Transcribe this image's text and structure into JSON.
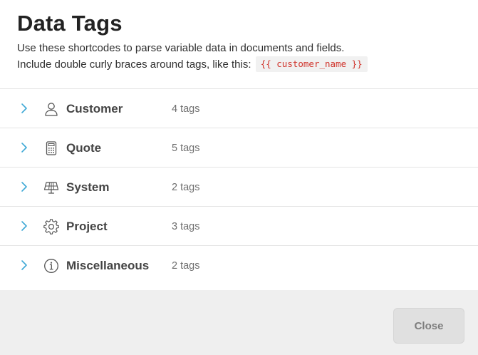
{
  "header": {
    "title": "Data Tags",
    "desc_line1": "Use these shortcodes to parse variable data in documents and fields.",
    "desc_line2": "Include double curly braces around tags, like this:",
    "example_code": "{{ customer_name }}"
  },
  "categories": [
    {
      "name": "Customer",
      "count": "4 tags",
      "icon": "person-icon"
    },
    {
      "name": "Quote",
      "count": "5 tags",
      "icon": "calculator-icon"
    },
    {
      "name": "System",
      "count": "2 tags",
      "icon": "solar-panel-icon"
    },
    {
      "name": "Project",
      "count": "3 tags",
      "icon": "gear-icon"
    },
    {
      "name": "Miscellaneous",
      "count": "2 tags",
      "icon": "info-icon"
    }
  ],
  "footer": {
    "close_label": "Close"
  },
  "colors": {
    "accent": "#3fa9d6",
    "code_text": "#d0332b",
    "footer_bg": "#efefef",
    "button_bg": "#e0e0e0"
  }
}
